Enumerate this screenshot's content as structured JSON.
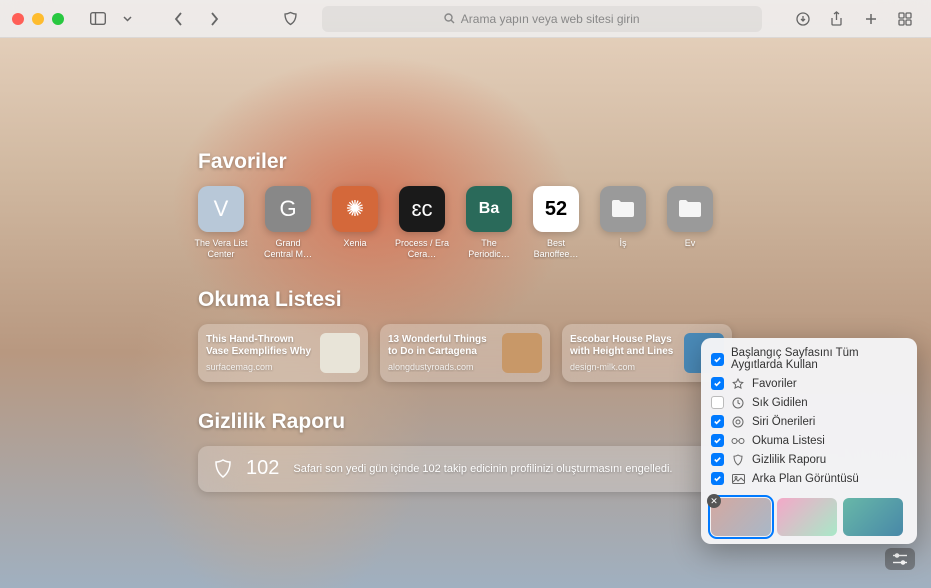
{
  "addressbar": {
    "placeholder": "Arama yapın veya web sitesi girin"
  },
  "sections": {
    "favorites_title": "Favoriler",
    "reading_title": "Okuma Listesi",
    "privacy_title": "Gizlilik Raporu"
  },
  "favorites": [
    {
      "label": "The Vera List Center",
      "glyph": "V",
      "cls": "ft-v"
    },
    {
      "label": "Grand Central M…",
      "glyph": "G",
      "cls": "ft-g"
    },
    {
      "label": "Xenia",
      "glyph": "✺",
      "cls": "ft-x"
    },
    {
      "label": "Process / Era Cera…",
      "glyph": "ɛc",
      "cls": "ft-p"
    },
    {
      "label": "The Periodic…",
      "glyph": "Ba",
      "cls": "ft-ba"
    },
    {
      "label": "Best Banoffee…",
      "glyph": "52",
      "cls": "ft-52"
    },
    {
      "label": "İş",
      "glyph": "folder",
      "cls": "ft-fold"
    },
    {
      "label": "Ev",
      "glyph": "folder",
      "cls": "ft-fold"
    }
  ],
  "reading": [
    {
      "title": "This Hand-Thrown Vase Exemplifies Why Cera…",
      "domain": "surfacemag.com",
      "thumb": "#e8e4d8"
    },
    {
      "title": "13 Wonderful Things to Do in Cartagena",
      "domain": "alongdustyroads.com",
      "thumb": "#c89868"
    },
    {
      "title": "Escobar House Plays with Height and Lines t…",
      "domain": "design-milk.com",
      "thumb": "#4a8ab8"
    }
  ],
  "privacy": {
    "count": "102",
    "text": "Safari son yedi gün içinde 102 takip edicinin profilinizi oluşturmasını engelledi."
  },
  "popover": {
    "items": [
      {
        "label": "Başlangıç Sayfasını Tüm Aygıtlarda Kullan",
        "checked": true,
        "icon": ""
      },
      {
        "label": "Favoriler",
        "checked": true,
        "icon": "star"
      },
      {
        "label": "Sık Gidilen",
        "checked": false,
        "icon": "clock"
      },
      {
        "label": "Siri Önerileri",
        "checked": true,
        "icon": "siri"
      },
      {
        "label": "Okuma Listesi",
        "checked": true,
        "icon": "glasses"
      },
      {
        "label": "Gizlilik Raporu",
        "checked": true,
        "icon": "shield"
      },
      {
        "label": "Arka Plan Görüntüsü",
        "checked": true,
        "icon": "image"
      }
    ],
    "wallpapers": [
      {
        "bg": "linear-gradient(135deg,#d4a8a0,#a8b8c8)",
        "selected": true
      },
      {
        "bg": "linear-gradient(135deg,#f4a8c8,#a8e8c8)",
        "selected": false
      },
      {
        "bg": "linear-gradient(135deg,#68b8a8,#4888a8)",
        "selected": false
      }
    ]
  }
}
